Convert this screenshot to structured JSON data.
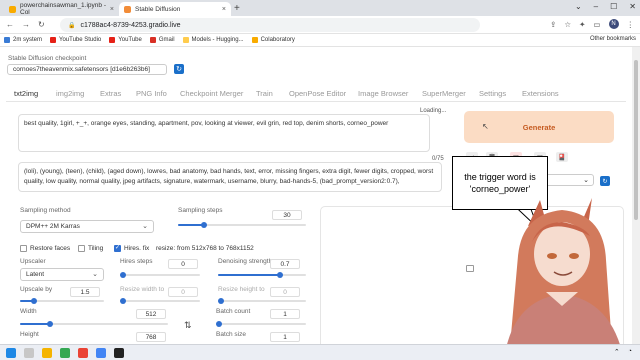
{
  "browser": {
    "tabs": [
      {
        "title": "powerchainsawman_1.ipynb - Col",
        "active": false
      },
      {
        "title": "Stable Diffusion",
        "active": true
      }
    ],
    "url": "c1788ac4-8739-4253.gradio.live",
    "profile_initial": "N"
  },
  "bookmarks": [
    {
      "label": "2m system",
      "color": "#3a7bd5"
    },
    {
      "label": "YouTube Studio",
      "color": "#e62117"
    },
    {
      "label": "YouTube",
      "color": "#e62117"
    },
    {
      "label": "Gmail",
      "color": "#d93025"
    },
    {
      "label": "Models - Hugging...",
      "color": "#ffcc4d"
    },
    {
      "label": "Colaboratory",
      "color": "#f9ab00"
    }
  ],
  "other_bookmarks": "Other bookmarks",
  "checkpoint": {
    "label": "Stable Diffusion checkpoint",
    "value": "cornoes7theavenmix.safetensors [d1e6b263b6]"
  },
  "main_tabs": [
    "txt2img",
    "img2img",
    "Extras",
    "PNG Info",
    "Checkpoint Merger",
    "Train",
    "OpenPose Editor",
    "Image Browser",
    "Settings",
    "SuperMerger",
    "Extensions"
  ],
  "prompt": {
    "positive": "best quality, 1girl, +_+, orange eyes, standing, apartment, pov, looking at viewer, evil grin, red top, denim shorts, corneo_power",
    "counter_pos": "Loading...",
    "negative": "(loli), (young), (teen), (child), (aged down), lowres, bad anatomy, bad hands, text, error, missing fingers, extra digit, fewer digits, cropped, worst quality, low quality, normal quality, jpeg artifacts, signature, watermark, username, blurry, bad-hands-5, (bad_prompt_version2:0.7),",
    "counter_neg": "0/75"
  },
  "generate_label": "Generate",
  "params": {
    "sampling_method_label": "Sampling method",
    "sampling_method": "DPM++ 2M Karras",
    "sampling_steps_label": "Sampling steps",
    "sampling_steps": "30",
    "restore_faces": "Restore faces",
    "tiling": "Tiling",
    "hires_fix": "Hires. fix",
    "resize_text": "resize: from 512x768 to 768x1152",
    "upscaler_label": "Upscaler",
    "upscaler": "Latent",
    "hires_steps_label": "Hires steps",
    "hires_steps": "0",
    "denoise_label": "Denoising strength",
    "denoise": "0.7",
    "upscale_by_label": "Upscale by",
    "upscale_by": "1.5",
    "resize_w_label": "Resize width to",
    "resize_w": "0",
    "resize_h_label": "Resize height to",
    "resize_h": "0",
    "width_label": "Width",
    "width": "512",
    "height_label": "Height",
    "height": "768",
    "batch_count_label": "Batch count",
    "batch_count": "1",
    "batch_size_label": "Batch size",
    "batch_size": "1"
  },
  "levels": {
    "steps": 0.2,
    "hires_steps": 0.0,
    "denoise": 0.7,
    "upscale_by": 0.17,
    "resize_w": 0.0,
    "resize_h": 0.0,
    "width": 0.2,
    "height": 0.33,
    "batch_count": 0.0,
    "batch_size": 0.0
  },
  "bubble_text": "the trigger word is 'corneo_power'"
}
